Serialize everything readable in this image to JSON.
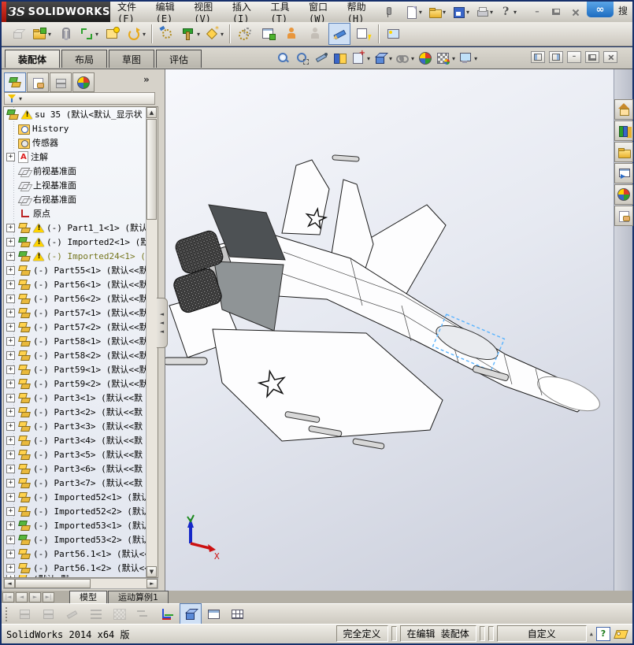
{
  "glyphs": {
    "dropdown": "▾",
    "up": "▲",
    "down": "▼",
    "left": "◄",
    "right": "►",
    "minimize": "–",
    "chevrons": "»",
    "triangle_small": "▲"
  },
  "titlebar": {
    "brand_prefix": "ЗS",
    "brand": "SOLIDWORKS",
    "search_hint": "搜",
    "menus": [
      "文件(F)",
      "编辑(E)",
      "视图(V)",
      "插入(I)",
      "工具(T)",
      "窗口(W)",
      "帮助(H)"
    ],
    "quick_tools": [
      {
        "name": "new-document",
        "icon": "i-sheet"
      },
      {
        "name": "open-document",
        "icon": "i-folder"
      },
      {
        "name": "save-document",
        "icon": "i-disk"
      },
      {
        "name": "print-document",
        "icon": "i-printer"
      },
      {
        "name": "help",
        "icon": "i-help"
      }
    ]
  },
  "command_tabs": {
    "items": [
      "装配体",
      "布局",
      "草图",
      "评估"
    ],
    "active_index": 0
  },
  "assembly_toolbar": [
    {
      "name": "edit-component",
      "icon": "i-cubey",
      "disabled": true
    },
    {
      "name": "insert-component",
      "icon": "i-folder g",
      "dd": true
    },
    {
      "name": "mate",
      "icon": "i-clip"
    },
    {
      "name": "linear-component-pattern",
      "icon": "i-brackets",
      "dd": true
    },
    {
      "name": "smart-fasteners",
      "icon": "i-winstar"
    },
    {
      "name": "move-component",
      "icon": "i-rotate",
      "dd": true
    },
    {
      "name": "sep"
    },
    {
      "name": "show-hidden-components",
      "icon": "i-gearb"
    },
    {
      "name": "assembly-features",
      "icon": "i-hammer",
      "dd": true
    },
    {
      "name": "reference-geometry",
      "icon": "i-diamond",
      "dd": true
    },
    {
      "name": "sep"
    },
    {
      "name": "new-motion-study",
      "icon": "i-gears"
    },
    {
      "name": "bill-of-materials",
      "icon": "i-wincube"
    },
    {
      "name": "exploded-view",
      "icon": "i-person"
    },
    {
      "name": "explode-line-sketch",
      "icon": "i-person",
      "disabled": true
    },
    {
      "name": "isolate",
      "icon": "i-pencilblue",
      "pressed": true
    },
    {
      "name": "instant3d",
      "icon": "i-winbolt"
    },
    {
      "name": "sep"
    },
    {
      "name": "take-snapshot",
      "icon": "i-pic"
    }
  ],
  "headsup_toolbar": [
    {
      "name": "zoom-to-fit",
      "icon": "i-mag"
    },
    {
      "name": "zoom-to-area",
      "icon": "i-magarea"
    },
    {
      "name": "previous-view",
      "icon": "i-knife"
    },
    {
      "name": "section-view",
      "icon": "i-book"
    },
    {
      "name": "view-orientation",
      "icon": "i-sheetplus",
      "dd": true
    },
    {
      "name": "display-style",
      "icon": "i-cube3d",
      "dd": true
    },
    {
      "name": "hide-show-items",
      "icon": "i-glasses",
      "dd": true
    },
    {
      "name": "edit-appearance",
      "icon": "i-ball"
    },
    {
      "name": "apply-scene",
      "icon": "i-scene",
      "dd": true
    },
    {
      "name": "view-settings",
      "icon": "i-monitor",
      "dd": true
    }
  ],
  "doc_window_buttons": [
    "pane-left",
    "pane-right",
    "minimize-doc",
    "restore-doc",
    "close-doc"
  ],
  "feature_panel": {
    "tabs": [
      "featuremanager-design-tree",
      "propertymanager",
      "configurationmanager",
      "displaymanager"
    ],
    "overflow_label": "»",
    "root": {
      "label": "su 35  (默认<默认_显示状",
      "warn": true
    },
    "items": [
      {
        "label": "History",
        "icon": "history"
      },
      {
        "label": "传感器",
        "icon": "sensors"
      },
      {
        "label": "注解",
        "icon": "annotations",
        "expand": true
      },
      {
        "label": "前视基准面",
        "icon": "plane"
      },
      {
        "label": "上视基准面",
        "icon": "plane"
      },
      {
        "label": "右视基准面",
        "icon": "plane"
      },
      {
        "label": "原点",
        "icon": "origin"
      },
      {
        "label": "(-) Part1_1<1> (默认",
        "icon": "part",
        "warn": true,
        "expand": true
      },
      {
        "label": "(-) Imported2<1> (默",
        "icon": "part-green",
        "warn": true,
        "expand": true
      },
      {
        "label": "(-) Imported24<1> (默",
        "icon": "part-green",
        "warn": true,
        "expand": true,
        "olive": true
      },
      {
        "label": "(-) Part55<1> (默认<<默",
        "icon": "part",
        "expand": true
      },
      {
        "label": "(-) Part56<1> (默认<<默",
        "icon": "part",
        "expand": true
      },
      {
        "label": "(-) Part56<2> (默认<<默",
        "icon": "part",
        "expand": true
      },
      {
        "label": "(-) Part57<1> (默认<<默",
        "icon": "part",
        "expand": true
      },
      {
        "label": "(-) Part57<2> (默认<<默",
        "icon": "part",
        "expand": true
      },
      {
        "label": "(-) Part58<1> (默认<<默",
        "icon": "part",
        "expand": true
      },
      {
        "label": "(-) Part58<2> (默认<<默",
        "icon": "part",
        "expand": true
      },
      {
        "label": "(-) Part59<1> (默认<<默",
        "icon": "part",
        "expand": true
      },
      {
        "label": "(-) Part59<2> (默认<<默",
        "icon": "part",
        "expand": true
      },
      {
        "label": "(-) Part3<1> (默认<<默",
        "icon": "part",
        "expand": true
      },
      {
        "label": "(-) Part3<2> (默认<<默",
        "icon": "part",
        "expand": true
      },
      {
        "label": "(-) Part3<3> (默认<<默",
        "icon": "part",
        "expand": true
      },
      {
        "label": "(-) Part3<4> (默认<<默",
        "icon": "part",
        "expand": true
      },
      {
        "label": "(-) Part3<5> (默认<<默",
        "icon": "part",
        "expand": true
      },
      {
        "label": "(-) Part3<6> (默认<<默",
        "icon": "part",
        "expand": true
      },
      {
        "label": "(-) Part3<7> (默认<<默",
        "icon": "part",
        "expand": true
      },
      {
        "label": "(-) Imported52<1> (默认",
        "icon": "part",
        "expand": true
      },
      {
        "label": "(-) Imported52<2> (默认",
        "icon": "part",
        "expand": true
      },
      {
        "label": "(-) Imported53<1> (默认",
        "icon": "part-green",
        "expand": true
      },
      {
        "label": "(-) Imported53<2> (默认",
        "icon": "part-green",
        "expand": true
      },
      {
        "label": "(-) Part56.1<1> (默认<<",
        "icon": "part",
        "expand": true
      },
      {
        "label": "(-) Part56.1<2> (默认<<",
        "icon": "part",
        "expand": true
      },
      {
        "label": "(默认<默",
        "icon": "part",
        "expand": true,
        "partial": true
      }
    ]
  },
  "viewport": {
    "model_name": "su-35-assembly",
    "triad_x_label": "X"
  },
  "task_pane": [
    {
      "name": "solidworks-resources",
      "icon": "i-house"
    },
    {
      "name": "design-library",
      "icon": "i-books"
    },
    {
      "name": "file-explorer",
      "icon": "i-folder"
    },
    {
      "name": "view-palette",
      "icon": "i-monarrow"
    },
    {
      "name": "appearances-scenes",
      "icon": "i-ball"
    },
    {
      "name": "custom-properties",
      "icon": "i-hand"
    }
  ],
  "bottom_tabs": {
    "nav": [
      "first-tab",
      "previous-tab",
      "next-tab",
      "last-tab"
    ],
    "nav_glyphs": [
      "|◄",
      "◄",
      "►",
      "►|"
    ],
    "items": [
      "模型",
      "运动算例1"
    ],
    "active_index": 0
  },
  "filter_toolbar": [
    {
      "name": "filter-vertices",
      "icon": "i-sheet2 i-stack",
      "disabled": true
    },
    {
      "name": "filter-edges",
      "icon": "i-stack",
      "disabled": true
    },
    {
      "name": "filter-faces",
      "icon": "i-pencil",
      "disabled": true
    },
    {
      "name": "filter-wireframe",
      "icon": "i-lines",
      "disabled": true
    },
    {
      "name": "filter-mesh",
      "icon": "i-gridfade",
      "disabled": true
    },
    {
      "name": "filter-toggle",
      "icon": "i-swap",
      "disabled": true
    },
    {
      "name": "filter-coordinate-system",
      "icon": "i-axes"
    },
    {
      "name": "filter-solid-bodies",
      "icon": "i-cube3d",
      "pressed": true
    },
    {
      "name": "filter-single-view",
      "icon": "i-winview"
    },
    {
      "name": "filter-multi-view",
      "icon": "i-grid"
    }
  ],
  "statusbar": {
    "version": "SolidWorks 2014 x64 版",
    "definition_status": "完全定义",
    "editing_status": "在编辑 装配体",
    "custom_label": "自定义",
    "help_label": "?"
  }
}
